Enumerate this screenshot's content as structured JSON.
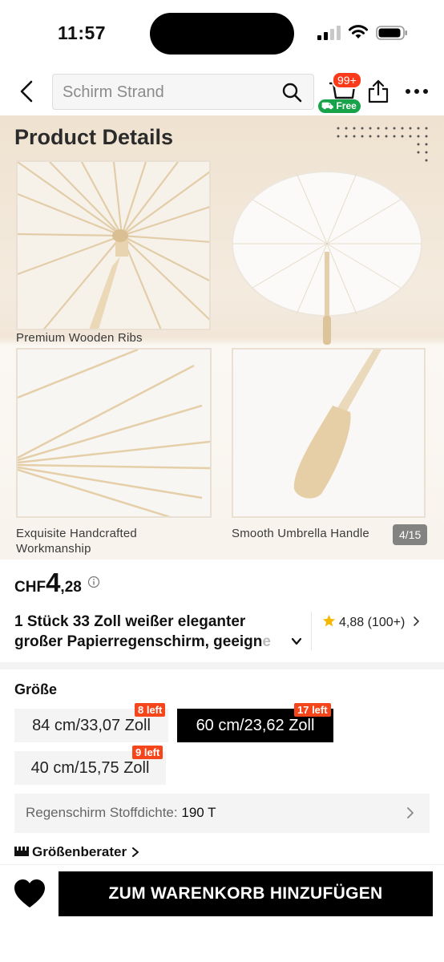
{
  "status_bar": {
    "time": "11:57"
  },
  "search": {
    "query": "Schirm Strand"
  },
  "cart": {
    "count_badge": "99+",
    "free_label": "Free"
  },
  "gallery": {
    "heading": "Product Details",
    "captions": [
      "Premium Wooden Ribs",
      "Exquisite Handcrafted Workmanship",
      "Smooth Umbrella Handle"
    ],
    "pager": "4/15"
  },
  "product": {
    "currency": "CHF",
    "price_int": "4",
    "price_dec": ",28",
    "title_line1": "1 Stück 33 Zoll weißer eleganter",
    "title_line2": "großer Papierregenschirm, geeign",
    "title_fade": "e",
    "rating": "4,88 (100+)"
  },
  "size": {
    "label": "Größe",
    "options": [
      {
        "label": "84 cm/33,07 Zoll",
        "badge": "8 left",
        "selected": false
      },
      {
        "label": "60 cm/23,62 Zoll",
        "badge": "17 left",
        "selected": true
      },
      {
        "label": "40 cm/15,75 Zoll",
        "badge": "9 left",
        "selected": false
      }
    ]
  },
  "density": {
    "label": "Regenschirm Stoffdichte:",
    "value": "190 T"
  },
  "size_guide": {
    "label": "Größenberater"
  },
  "cta": {
    "add_to_cart": "ZUM WARENKORB HINZUFÜGEN"
  },
  "colors": {
    "accent_red": "#fa3b1b",
    "badge_orange": "#f4461a",
    "free_green": "#18a24a",
    "primary": "#000000",
    "star": "#f5b800"
  }
}
